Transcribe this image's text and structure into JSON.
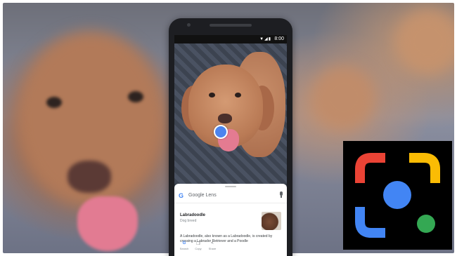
{
  "phone": {
    "status_time": "8:00",
    "status_icons": "▼◢▮"
  },
  "lens_sheet": {
    "brand_g": "G",
    "title": "Google Lens",
    "result_title": "Labradoodle",
    "result_subtitle": "Dog breed",
    "result_description": "A Labradoodle, also known as a Labradoodle, is created by crossing a Labrador Retriever and a Poodle",
    "actions": [
      {
        "icon": "google-g-icon",
        "glyph": "G",
        "label": "Search"
      },
      {
        "icon": "copy-icon",
        "glyph": "❐",
        "label": "Copy"
      },
      {
        "icon": "share-icon",
        "glyph": "<",
        "label": "Share"
      }
    ]
  },
  "logo": {
    "name": "google-lens-logo",
    "colors": {
      "red": "#ea4335",
      "yellow": "#fbbc04",
      "blue": "#4285f4",
      "green": "#34a853"
    }
  }
}
